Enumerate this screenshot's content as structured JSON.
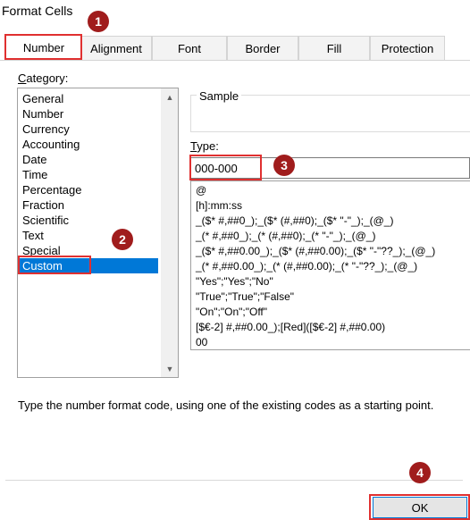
{
  "dialog": {
    "title": "Format Cells"
  },
  "tabs": [
    "Number",
    "Alignment",
    "Font",
    "Border",
    "Fill",
    "Protection"
  ],
  "category": {
    "label_prefix": "C",
    "label_rest": "ategory:",
    "items": [
      "General",
      "Number",
      "Currency",
      "Accounting",
      "Date",
      "Time",
      "Percentage",
      "Fraction",
      "Scientific",
      "Text",
      "Special",
      "Custom"
    ],
    "selected": "Custom"
  },
  "sample": {
    "label": "Sample"
  },
  "type": {
    "label_prefix": "T",
    "label_rest": "ype:",
    "value": "000-000"
  },
  "formats": [
    "@",
    "[h]:mm:ss",
    "_($* #,##0_);_($* (#,##0);_($* \"-\"_);_(@_)",
    "_(* #,##0_);_(* (#,##0);_(* \"-\"_);_(@_)",
    "_($* #,##0.00_);_($* (#,##0.00);_($* \"-\"??_);_(@_)",
    "_(* #,##0.00_);_(* (#,##0.00);_(* \"-\"??_);_(@_)",
    "\"Yes\";\"Yes\";\"No\"",
    "\"True\";\"True\";\"False\"",
    "\"On\";\"On\";\"Off\"",
    "[$€-2] #,##0.00_);[Red]([$€-2] #,##0.00)",
    "00"
  ],
  "hint": "Type the number format code, using one of the existing codes as a starting point.",
  "buttons": {
    "ok": "OK"
  },
  "annotations": [
    "1",
    "2",
    "3",
    "4"
  ],
  "colors": {
    "selection": "#0078d7",
    "annotation": "#e03030",
    "badge": "#a01c1c"
  }
}
